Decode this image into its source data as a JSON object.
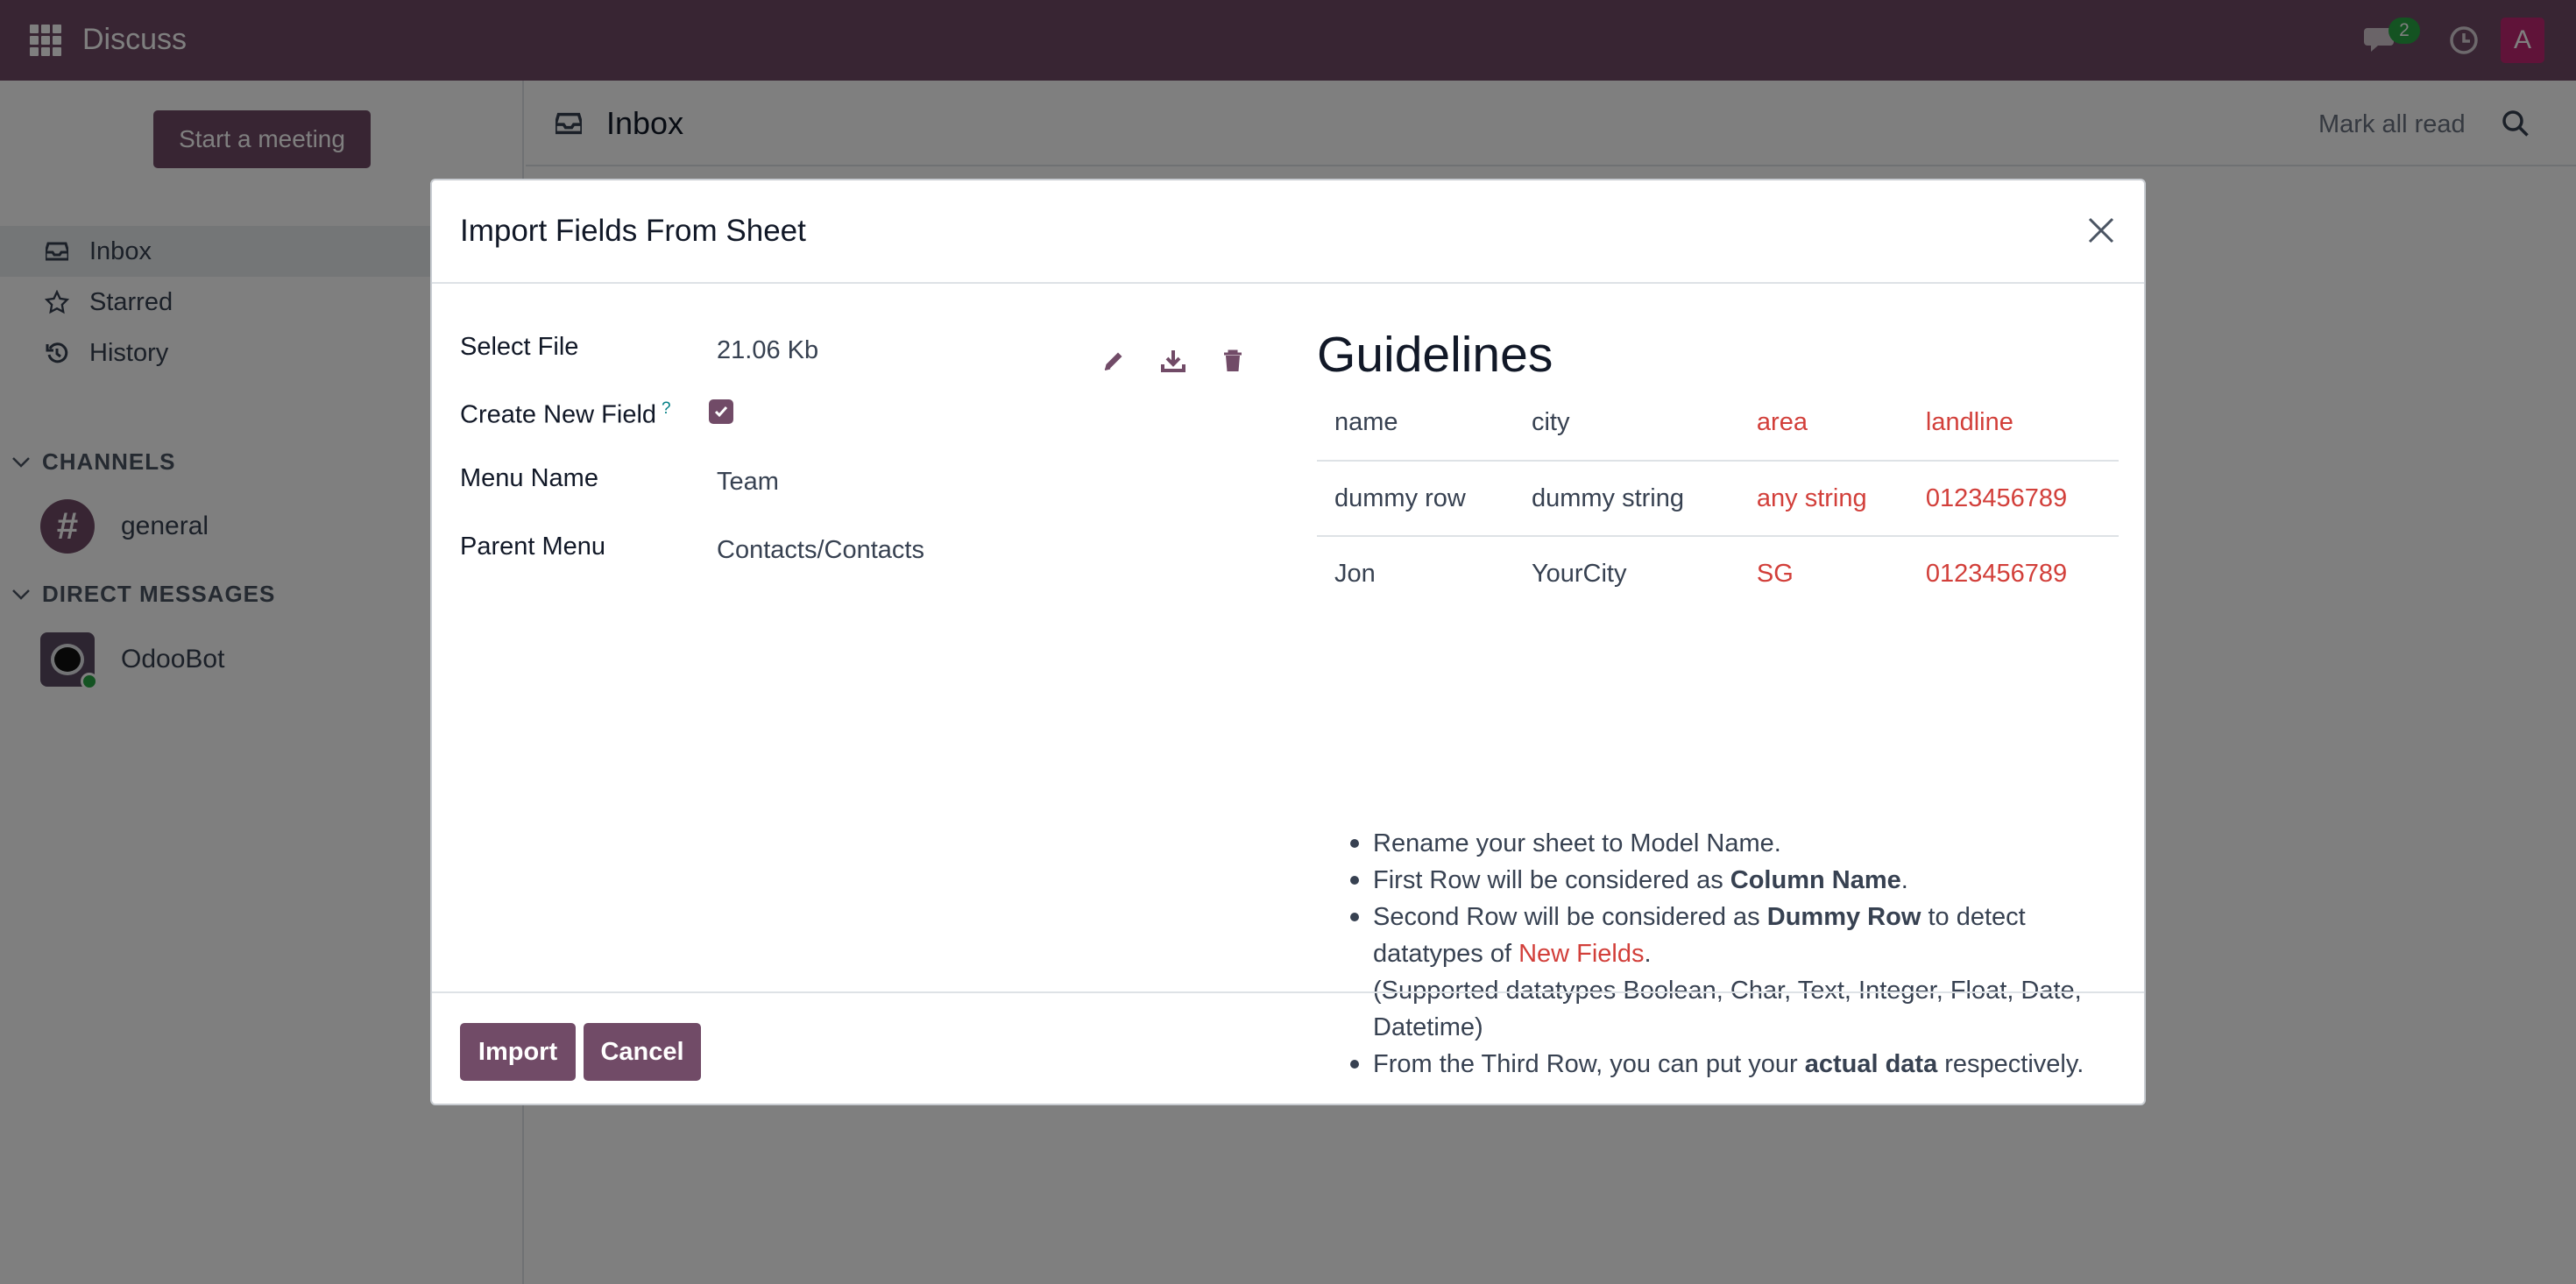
{
  "navbar": {
    "app_name": "Discuss",
    "chat_badge": "2",
    "avatar_letter": "A"
  },
  "sidebar": {
    "start_meeting": "Start a meeting",
    "items": [
      {
        "label": "Inbox",
        "icon": "inbox-icon"
      },
      {
        "label": "Starred",
        "icon": "star-icon"
      },
      {
        "label": "History",
        "icon": "history-icon"
      }
    ],
    "channels_header": "CHANNELS",
    "channels": [
      {
        "label": "general"
      }
    ],
    "dm_header": "DIRECT MESSAGES",
    "direct_messages": [
      {
        "label": "OdooBot"
      }
    ]
  },
  "main": {
    "title": "Inbox",
    "mark_all_read": "Mark all read"
  },
  "modal": {
    "title": "Import Fields From Sheet",
    "fields": {
      "select_file_label": "Select File",
      "select_file_value": "21.06 Kb",
      "create_new_field_label": "Create New Field",
      "help_mark": "?",
      "create_new_field_checked": true,
      "menu_name_label": "Menu Name",
      "menu_name_value": "Team",
      "parent_menu_label": "Parent Menu",
      "parent_menu_value": "Contacts/Contacts"
    },
    "guidelines": {
      "title": "Guidelines",
      "table": [
        [
          "name",
          "city",
          "area",
          "landline"
        ],
        [
          "dummy row",
          "dummy string",
          "any string",
          "0123456789"
        ],
        [
          "Jon",
          "YourCity",
          "SG",
          "0123456789"
        ]
      ],
      "list": {
        "item1": "Rename your sheet to Model Name.",
        "item2_pre": "First Row will be considered as ",
        "item2_bold": "Column Name",
        "item2_post": ".",
        "item3_pre": "Second Row will be considered as ",
        "item3_bold": "Dummy Row",
        "item3_mid": " to detect datatypes of ",
        "item3_red": "New Fields",
        "item3_post": ".",
        "item3_note": "(Supported datatypes Boolean, Char, Text, Integer, Float, Date, Datetime)",
        "item4_pre": "From the Third Row, you can put your ",
        "item4_bold": "actual data",
        "item4_post": " respectively."
      }
    },
    "buttons": {
      "import": "Import",
      "cancel": "Cancel"
    }
  },
  "colors": {
    "brand": "#714b67",
    "accent_red": "#d23f3a",
    "badge_green": "#28a745",
    "avatar_pink": "#c12672"
  }
}
